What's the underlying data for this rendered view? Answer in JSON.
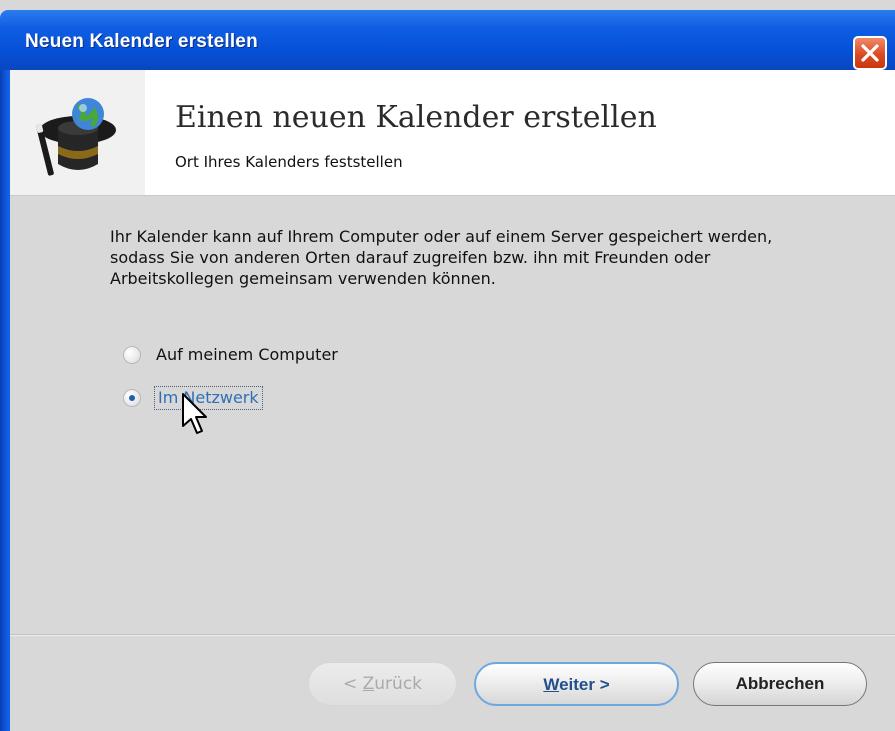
{
  "window": {
    "title": "Neuen Kalender erstellen",
    "close_icon": "close-icon"
  },
  "header": {
    "title": "Einen neuen Kalender erstellen",
    "subtitle": "Ort Ihres Kalenders feststellen",
    "icon": "wizard-hat-icon"
  },
  "body": {
    "description": "Ihr Kalender kann auf Ihrem Computer oder auf einem Server gespeichert werden, sodass Sie von anderen Orten darauf zugreifen bzw. ihn mit Freunden oder Arbeitskollegen gemeinsam verwenden können.",
    "options": [
      {
        "label": "Auf meinem Computer",
        "selected": false
      },
      {
        "label": "Im Netzwerk",
        "selected": true
      }
    ]
  },
  "buttons": {
    "back": {
      "underlined": "Z",
      "rest": "urück",
      "prefix": "< ",
      "enabled": false
    },
    "next": {
      "underlined": "W",
      "rest": "eiter >",
      "enabled": true
    },
    "cancel": {
      "label": "Abbrechen",
      "enabled": true
    }
  },
  "colors": {
    "titlebar": "#0650d6",
    "dialog_background": "#d8d8d8",
    "focus_blue": "#2f6fb6"
  }
}
